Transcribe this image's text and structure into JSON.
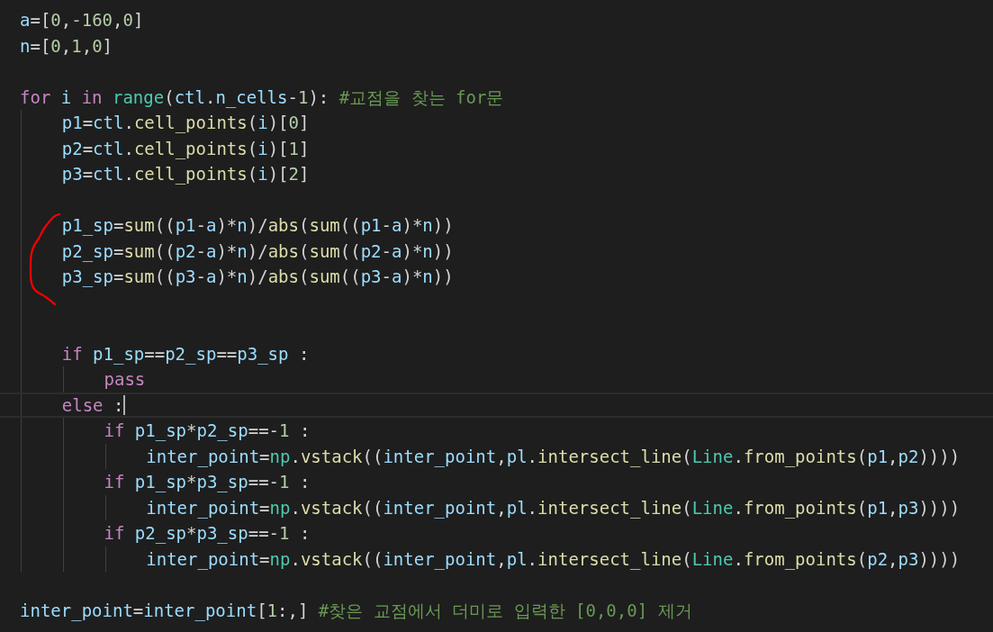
{
  "editor": {
    "lines": [
      {
        "kind": "code",
        "current": false,
        "tokens": [
          {
            "kind": "var",
            "text": "a"
          },
          {
            "kind": "op",
            "text": "=["
          },
          {
            "kind": "num",
            "text": "0"
          },
          {
            "kind": "op",
            "text": ","
          },
          {
            "kind": "num",
            "text": "-160"
          },
          {
            "kind": "op",
            "text": ","
          },
          {
            "kind": "num",
            "text": "0"
          },
          {
            "kind": "op",
            "text": "]"
          }
        ]
      },
      {
        "kind": "code",
        "current": false,
        "tokens": [
          {
            "kind": "var",
            "text": "n"
          },
          {
            "kind": "op",
            "text": "=["
          },
          {
            "kind": "num",
            "text": "0"
          },
          {
            "kind": "op",
            "text": ","
          },
          {
            "kind": "num",
            "text": "1"
          },
          {
            "kind": "op",
            "text": ","
          },
          {
            "kind": "num",
            "text": "0"
          },
          {
            "kind": "op",
            "text": "]"
          }
        ]
      },
      {
        "kind": "blank"
      },
      {
        "kind": "code",
        "current": false,
        "tokens": [
          {
            "kind": "kw",
            "text": "for"
          },
          {
            "kind": "var",
            "text": " i "
          },
          {
            "kind": "kw",
            "text": "in"
          },
          {
            "kind": "cls",
            "text": " range"
          },
          {
            "kind": "op",
            "text": "("
          },
          {
            "kind": "var",
            "text": "ctl"
          },
          {
            "kind": "op",
            "text": "."
          },
          {
            "kind": "var",
            "text": "n_cells"
          },
          {
            "kind": "op",
            "text": "-"
          },
          {
            "kind": "num",
            "text": "1"
          },
          {
            "kind": "op",
            "text": "): "
          },
          {
            "kind": "cmt",
            "text": "#교점을 찾는 for문"
          }
        ],
        "children": [
          {
            "kind": "code",
            "current": false,
            "tokens": [
              {
                "kind": "var",
                "text": "p1"
              },
              {
                "kind": "op",
                "text": "="
              },
              {
                "kind": "var",
                "text": "ctl"
              },
              {
                "kind": "op",
                "text": "."
              },
              {
                "kind": "fn",
                "text": "cell_points"
              },
              {
                "kind": "op",
                "text": "("
              },
              {
                "kind": "var",
                "text": "i"
              },
              {
                "kind": "op",
                "text": ")["
              },
              {
                "kind": "num",
                "text": "0"
              },
              {
                "kind": "op",
                "text": "]"
              }
            ]
          },
          {
            "kind": "code",
            "current": false,
            "tokens": [
              {
                "kind": "var",
                "text": "p2"
              },
              {
                "kind": "op",
                "text": "="
              },
              {
                "kind": "var",
                "text": "ctl"
              },
              {
                "kind": "op",
                "text": "."
              },
              {
                "kind": "fn",
                "text": "cell_points"
              },
              {
                "kind": "op",
                "text": "("
              },
              {
                "kind": "var",
                "text": "i"
              },
              {
                "kind": "op",
                "text": ")["
              },
              {
                "kind": "num",
                "text": "1"
              },
              {
                "kind": "op",
                "text": "]"
              }
            ]
          },
          {
            "kind": "code",
            "current": false,
            "tokens": [
              {
                "kind": "var",
                "text": "p3"
              },
              {
                "kind": "op",
                "text": "="
              },
              {
                "kind": "var",
                "text": "ctl"
              },
              {
                "kind": "op",
                "text": "."
              },
              {
                "kind": "fn",
                "text": "cell_points"
              },
              {
                "kind": "op",
                "text": "("
              },
              {
                "kind": "var",
                "text": "i"
              },
              {
                "kind": "op",
                "text": ")["
              },
              {
                "kind": "num",
                "text": "2"
              },
              {
                "kind": "op",
                "text": "]"
              }
            ]
          },
          {
            "kind": "blank"
          },
          {
            "kind": "code",
            "current": false,
            "tokens": [
              {
                "kind": "var",
                "text": "p1_sp"
              },
              {
                "kind": "op",
                "text": "="
              },
              {
                "kind": "fn",
                "text": "sum"
              },
              {
                "kind": "op",
                "text": "(("
              },
              {
                "kind": "var",
                "text": "p1"
              },
              {
                "kind": "op",
                "text": "-"
              },
              {
                "kind": "var",
                "text": "a"
              },
              {
                "kind": "op",
                "text": ")*"
              },
              {
                "kind": "var",
                "text": "n"
              },
              {
                "kind": "op",
                "text": ")/"
              },
              {
                "kind": "fn",
                "text": "abs"
              },
              {
                "kind": "op",
                "text": "("
              },
              {
                "kind": "fn",
                "text": "sum"
              },
              {
                "kind": "op",
                "text": "(("
              },
              {
                "kind": "var",
                "text": "p1"
              },
              {
                "kind": "op",
                "text": "-"
              },
              {
                "kind": "var",
                "text": "a"
              },
              {
                "kind": "op",
                "text": ")*"
              },
              {
                "kind": "var",
                "text": "n"
              },
              {
                "kind": "op",
                "text": "))"
              }
            ]
          },
          {
            "kind": "code",
            "current": false,
            "tokens": [
              {
                "kind": "var",
                "text": "p2_sp"
              },
              {
                "kind": "op",
                "text": "="
              },
              {
                "kind": "fn",
                "text": "sum"
              },
              {
                "kind": "op",
                "text": "(("
              },
              {
                "kind": "var",
                "text": "p2"
              },
              {
                "kind": "op",
                "text": "-"
              },
              {
                "kind": "var",
                "text": "a"
              },
              {
                "kind": "op",
                "text": ")*"
              },
              {
                "kind": "var",
                "text": "n"
              },
              {
                "kind": "op",
                "text": ")/"
              },
              {
                "kind": "fn",
                "text": "abs"
              },
              {
                "kind": "op",
                "text": "("
              },
              {
                "kind": "fn",
                "text": "sum"
              },
              {
                "kind": "op",
                "text": "(("
              },
              {
                "kind": "var",
                "text": "p2"
              },
              {
                "kind": "op",
                "text": "-"
              },
              {
                "kind": "var",
                "text": "a"
              },
              {
                "kind": "op",
                "text": ")*"
              },
              {
                "kind": "var",
                "text": "n"
              },
              {
                "kind": "op",
                "text": "))"
              }
            ]
          },
          {
            "kind": "code",
            "current": false,
            "tokens": [
              {
                "kind": "var",
                "text": "p3_sp"
              },
              {
                "kind": "op",
                "text": "="
              },
              {
                "kind": "fn",
                "text": "sum"
              },
              {
                "kind": "op",
                "text": "(("
              },
              {
                "kind": "var",
                "text": "p3"
              },
              {
                "kind": "op",
                "text": "-"
              },
              {
                "kind": "var",
                "text": "a"
              },
              {
                "kind": "op",
                "text": ")*"
              },
              {
                "kind": "var",
                "text": "n"
              },
              {
                "kind": "op",
                "text": ")/"
              },
              {
                "kind": "fn",
                "text": "abs"
              },
              {
                "kind": "op",
                "text": "("
              },
              {
                "kind": "fn",
                "text": "sum"
              },
              {
                "kind": "op",
                "text": "(("
              },
              {
                "kind": "var",
                "text": "p3"
              },
              {
                "kind": "op",
                "text": "-"
              },
              {
                "kind": "var",
                "text": "a"
              },
              {
                "kind": "op",
                "text": ")*"
              },
              {
                "kind": "var",
                "text": "n"
              },
              {
                "kind": "op",
                "text": "))"
              }
            ]
          },
          {
            "kind": "blank"
          },
          {
            "kind": "blank"
          },
          {
            "kind": "code",
            "current": false,
            "tokens": [
              {
                "kind": "kw",
                "text": "if"
              },
              {
                "kind": "var",
                "text": " p1_sp"
              },
              {
                "kind": "op",
                "text": "=="
              },
              {
                "kind": "var",
                "text": "p2_sp"
              },
              {
                "kind": "op",
                "text": "=="
              },
              {
                "kind": "var",
                "text": "p3_sp"
              },
              {
                "kind": "op",
                "text": " :"
              }
            ],
            "children": [
              {
                "kind": "code",
                "current": false,
                "tokens": [
                  {
                    "kind": "kw",
                    "text": "pass"
                  }
                ]
              }
            ]
          },
          {
            "kind": "code",
            "current": true,
            "tokens": [
              {
                "kind": "kw",
                "text": "else"
              },
              {
                "kind": "op",
                "text": " :"
              }
            ],
            "children": [
              {
                "kind": "code",
                "current": false,
                "tokens": [
                  {
                    "kind": "kw",
                    "text": "if"
                  },
                  {
                    "kind": "var",
                    "text": " p1_sp"
                  },
                  {
                    "kind": "op",
                    "text": "*"
                  },
                  {
                    "kind": "var",
                    "text": "p2_sp"
                  },
                  {
                    "kind": "op",
                    "text": "==-"
                  },
                  {
                    "kind": "num",
                    "text": "1"
                  },
                  {
                    "kind": "op",
                    "text": " :"
                  }
                ],
                "children": [
                  {
                    "kind": "code",
                    "current": false,
                    "tokens": [
                      {
                        "kind": "var",
                        "text": "inter_point"
                      },
                      {
                        "kind": "op",
                        "text": "="
                      },
                      {
                        "kind": "cls",
                        "text": "np"
                      },
                      {
                        "kind": "op",
                        "text": "."
                      },
                      {
                        "kind": "fn",
                        "text": "vstack"
                      },
                      {
                        "kind": "op",
                        "text": "(("
                      },
                      {
                        "kind": "var",
                        "text": "inter_point"
                      },
                      {
                        "kind": "op",
                        "text": ","
                      },
                      {
                        "kind": "var",
                        "text": "pl"
                      },
                      {
                        "kind": "op",
                        "text": "."
                      },
                      {
                        "kind": "fn",
                        "text": "intersect_line"
                      },
                      {
                        "kind": "op",
                        "text": "("
                      },
                      {
                        "kind": "cls",
                        "text": "Line"
                      },
                      {
                        "kind": "op",
                        "text": "."
                      },
                      {
                        "kind": "fn",
                        "text": "from_points"
                      },
                      {
                        "kind": "op",
                        "text": "("
                      },
                      {
                        "kind": "var",
                        "text": "p1"
                      },
                      {
                        "kind": "op",
                        "text": ","
                      },
                      {
                        "kind": "var",
                        "text": "p2"
                      },
                      {
                        "kind": "op",
                        "text": "))))"
                      }
                    ]
                  }
                ]
              },
              {
                "kind": "code",
                "current": false,
                "tokens": [
                  {
                    "kind": "kw",
                    "text": "if"
                  },
                  {
                    "kind": "var",
                    "text": " p1_sp"
                  },
                  {
                    "kind": "op",
                    "text": "*"
                  },
                  {
                    "kind": "var",
                    "text": "p3_sp"
                  },
                  {
                    "kind": "op",
                    "text": "==-"
                  },
                  {
                    "kind": "num",
                    "text": "1"
                  },
                  {
                    "kind": "op",
                    "text": " :"
                  }
                ],
                "children": [
                  {
                    "kind": "code",
                    "current": false,
                    "tokens": [
                      {
                        "kind": "var",
                        "text": "inter_point"
                      },
                      {
                        "kind": "op",
                        "text": "="
                      },
                      {
                        "kind": "cls",
                        "text": "np"
                      },
                      {
                        "kind": "op",
                        "text": "."
                      },
                      {
                        "kind": "fn",
                        "text": "vstack"
                      },
                      {
                        "kind": "op",
                        "text": "(("
                      },
                      {
                        "kind": "var",
                        "text": "inter_point"
                      },
                      {
                        "kind": "op",
                        "text": ","
                      },
                      {
                        "kind": "var",
                        "text": "pl"
                      },
                      {
                        "kind": "op",
                        "text": "."
                      },
                      {
                        "kind": "fn",
                        "text": "intersect_line"
                      },
                      {
                        "kind": "op",
                        "text": "("
                      },
                      {
                        "kind": "cls",
                        "text": "Line"
                      },
                      {
                        "kind": "op",
                        "text": "."
                      },
                      {
                        "kind": "fn",
                        "text": "from_points"
                      },
                      {
                        "kind": "op",
                        "text": "("
                      },
                      {
                        "kind": "var",
                        "text": "p1"
                      },
                      {
                        "kind": "op",
                        "text": ","
                      },
                      {
                        "kind": "var",
                        "text": "p3"
                      },
                      {
                        "kind": "op",
                        "text": "))))"
                      }
                    ]
                  }
                ]
              },
              {
                "kind": "code",
                "current": false,
                "tokens": [
                  {
                    "kind": "kw",
                    "text": "if"
                  },
                  {
                    "kind": "var",
                    "text": " p2_sp"
                  },
                  {
                    "kind": "op",
                    "text": "*"
                  },
                  {
                    "kind": "var",
                    "text": "p3_sp"
                  },
                  {
                    "kind": "op",
                    "text": "==-"
                  },
                  {
                    "kind": "num",
                    "text": "1"
                  },
                  {
                    "kind": "op",
                    "text": " :"
                  }
                ],
                "children": [
                  {
                    "kind": "code",
                    "current": false,
                    "tokens": [
                      {
                        "kind": "var",
                        "text": "inter_point"
                      },
                      {
                        "kind": "op",
                        "text": "="
                      },
                      {
                        "kind": "cls",
                        "text": "np"
                      },
                      {
                        "kind": "op",
                        "text": "."
                      },
                      {
                        "kind": "fn",
                        "text": "vstack"
                      },
                      {
                        "kind": "op",
                        "text": "(("
                      },
                      {
                        "kind": "var",
                        "text": "inter_point"
                      },
                      {
                        "kind": "op",
                        "text": ","
                      },
                      {
                        "kind": "var",
                        "text": "pl"
                      },
                      {
                        "kind": "op",
                        "text": "."
                      },
                      {
                        "kind": "fn",
                        "text": "intersect_line"
                      },
                      {
                        "kind": "op",
                        "text": "("
                      },
                      {
                        "kind": "cls",
                        "text": "Line"
                      },
                      {
                        "kind": "op",
                        "text": "."
                      },
                      {
                        "kind": "fn",
                        "text": "from_points"
                      },
                      {
                        "kind": "op",
                        "text": "("
                      },
                      {
                        "kind": "var",
                        "text": "p2"
                      },
                      {
                        "kind": "op",
                        "text": ","
                      },
                      {
                        "kind": "var",
                        "text": "p3"
                      },
                      {
                        "kind": "op",
                        "text": "))))"
                      }
                    ]
                  }
                ]
              }
            ]
          }
        ]
      },
      {
        "kind": "blank"
      },
      {
        "kind": "code",
        "current": false,
        "tokens": [
          {
            "kind": "var",
            "text": "inter_point"
          },
          {
            "kind": "op",
            "text": "="
          },
          {
            "kind": "var",
            "text": "inter_point"
          },
          {
            "kind": "op",
            "text": "["
          },
          {
            "kind": "num",
            "text": "1"
          },
          {
            "kind": "op",
            "text": ":,] "
          },
          {
            "kind": "cmt",
            "text": "#찾은 교점에서 더미로 입력한 [0,0,0] 제거"
          }
        ]
      }
    ]
  }
}
